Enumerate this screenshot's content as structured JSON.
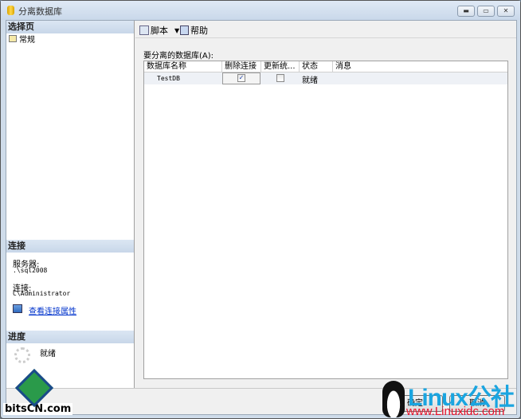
{
  "window": {
    "title": "分离数据库"
  },
  "left": {
    "select_page_header": "选择页",
    "pages": [
      {
        "label": "常规"
      }
    ],
    "connection_header": "连接",
    "server_label": "服务器:",
    "server_value": ".\\sql2008",
    "connection_label": "连接:",
    "connection_value": "C\\Administrator",
    "view_props_link": "查看连接属性",
    "progress_header": "进度",
    "progress_status": "就绪"
  },
  "toolbar": {
    "script_label": "脚本",
    "help_label": "帮助"
  },
  "main": {
    "grid_label": "要分离的数据库(A):",
    "columns": [
      "数据库名称",
      "删除连接",
      "更新统...",
      "状态",
      "消息"
    ],
    "rows": [
      {
        "name": "TestDB",
        "drop_connections": true,
        "update_stats": false,
        "status": "就绪",
        "message": ""
      }
    ]
  },
  "buttons": {
    "ok": "确定",
    "cancel": "取消"
  },
  "watermarks": {
    "left": "bitsCN.com",
    "right_big": "Linux公社",
    "right_url": "www.Linuxidc.com"
  }
}
